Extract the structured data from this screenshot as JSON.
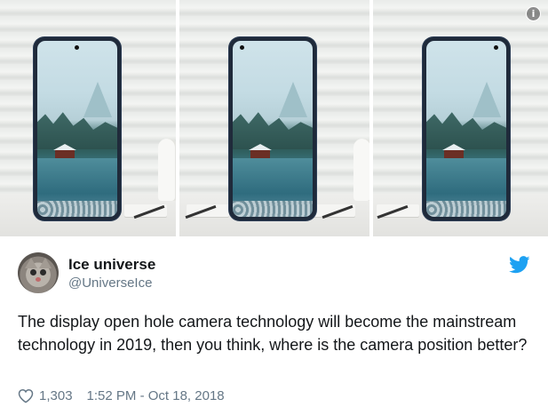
{
  "media": {
    "panels": [
      {
        "alt": "phone-render-1"
      },
      {
        "alt": "phone-render-2"
      },
      {
        "alt": "phone-render-3"
      }
    ],
    "info_icon": "info-icon"
  },
  "tweet": {
    "author_name": "Ice universe",
    "author_handle": "@UniverseIce",
    "text": "The display open hole camera technology will become the mainstream technology in 2019, then you think, where is the camera position better?",
    "likes": "1,303",
    "timestamp": "1:52 PM - Oct 18, 2018"
  },
  "icons": {
    "brand": "twitter-bird-icon",
    "like": "heart-icon"
  },
  "colors": {
    "twitter_blue": "#1da1f2",
    "secondary_text": "#657786",
    "primary_text": "#14171a"
  }
}
